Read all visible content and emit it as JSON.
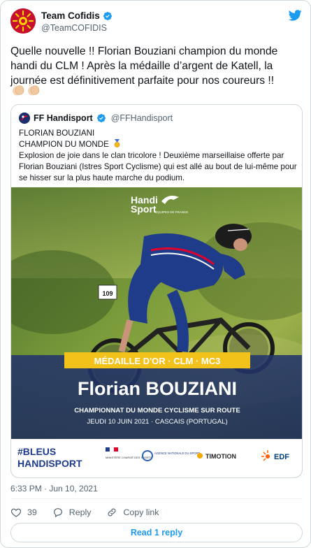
{
  "author": {
    "name": "Team Cofidis",
    "handle": "@TeamCOFIDIS"
  },
  "tweet": {
    "text": "Quelle nouvelle !! Florian Bouziani champion du monde handi du CLM ! Après la médaille d’argent de Katell, la journée est définitivement parfaite pour nos coureurs !!",
    "emoji": [
      "clapping-hands",
      "clapping-hands"
    ]
  },
  "quoted": {
    "name": "FF Handisport",
    "handle": "@FFHandisport",
    "line1": "FLORIAN BOUZIANI",
    "line2": "CHAMPION DU MONDE",
    "line2_emoji": "gold-medal",
    "body": "Explosion de joie dans le clan tricolore ! Deuxième marseillaise offerte par Florian Bouziani (Istres Sport Cyclisme) qui est allé au bout de lui-même pour se hisser sur la plus haute marche du podium.",
    "image": {
      "logo_line1": "Handi",
      "logo_line2": "Sport",
      "logo_tag": "ÉQUIPES DE FRANCE",
      "bib_number": "109",
      "banner": "MÉDAILLE D'OR · CLM · MC3",
      "athlete": "Florian BOUZIANI",
      "event": "CHAMPIONNAT DU MONDE CYCLISME SUR ROUTE",
      "date_place": "JEUDI 10 JUIN 2021 · CASCAIS (PORTUGAL)",
      "footer_brand_1": "#BLEUS",
      "footer_brand_2": "HANDISPORT",
      "ministry": "MINISTÈRE CHARGÉ DES SPORTS",
      "agency": "AGENCE NATIONALE DU SPORT",
      "sponsor_1": "TIMOTION",
      "sponsor_2": "EDF"
    }
  },
  "meta": {
    "timestamp": "6:33 PM · Jun 10, 2021"
  },
  "actions": {
    "likes": "39",
    "reply_label": "Reply",
    "copy_label": "Copy link"
  },
  "read_reply_label": "Read 1 reply",
  "colors": {
    "twitter_blue": "#1d9bf0",
    "cofidis_red": "#c8102e",
    "like_red": "#f91880",
    "banner_gold": "#f2c21a",
    "poster_navy": "#1c2d5a"
  }
}
